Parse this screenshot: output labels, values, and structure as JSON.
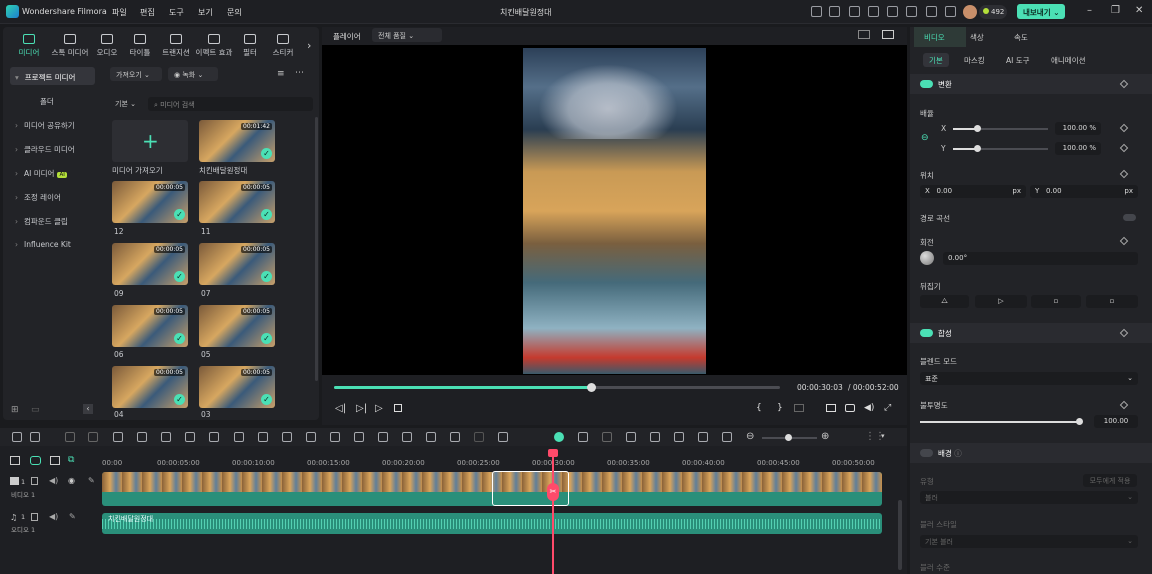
{
  "titlebar": {
    "app_name": "Wondershare Filmora",
    "menus": [
      "파일",
      "편집",
      "도구",
      "보기",
      "문의"
    ],
    "window_title": "치킨배달원정대",
    "credits": "492",
    "export_label": "내보내기 ⌄"
  },
  "left": {
    "tabs": [
      "미디어",
      "스톡 미디어",
      "오디오",
      "타이틀",
      "트랜지션",
      "이펙트 효과",
      "필터",
      "스티커"
    ],
    "sidebar": [
      {
        "label": "프로젝트 미디어",
        "tag": ""
      },
      {
        "label": "폴더",
        "tag": ""
      },
      {
        "label": "미디어 공유하기",
        "tag": ""
      },
      {
        "label": "클라우드 미디어",
        "tag": ""
      },
      {
        "label": "AI 미디어",
        "tag": "AI"
      },
      {
        "label": "조정 레이어",
        "tag": ""
      },
      {
        "label": "컴파운드 클립",
        "tag": ""
      },
      {
        "label": "Influence Kit",
        "tag": ""
      }
    ],
    "import_btn": "가져오기",
    "record_btn": "녹화",
    "sort_btn": "기본",
    "search_placeholder": "미디어 검색",
    "media": [
      {
        "name": "미디어 가져오기",
        "duration": ""
      },
      {
        "name": "치킨배달원정대",
        "duration": "00:01:42"
      },
      {
        "name": "12",
        "duration": "00:00:05"
      },
      {
        "name": "11",
        "duration": "00:00:05"
      },
      {
        "name": "09",
        "duration": "00:00:05"
      },
      {
        "name": "07",
        "duration": "00:00:05"
      },
      {
        "name": "06",
        "duration": "00:00:05"
      },
      {
        "name": "05",
        "duration": "00:00:05"
      },
      {
        "name": "04",
        "duration": "00:00:05"
      },
      {
        "name": "03",
        "duration": "00:00:05"
      }
    ]
  },
  "player": {
    "label": "플레이어",
    "quality": "전체 품질",
    "current": "00:00:30:03",
    "total": "/ 00:00:52:00",
    "progress": 0.577
  },
  "right": {
    "tabs": [
      "비디오",
      "색상",
      "속도"
    ],
    "subtabs": [
      "기본",
      "마스킹",
      "AI 도구",
      "애니메이션"
    ],
    "transform": {
      "title": "변환",
      "scale_label": "배율",
      "x": "X",
      "y": "Y",
      "scale_x": "100.00",
      "scale_y": "100.00",
      "pct": "%",
      "pos_label": "위치",
      "pos_x": "0.00",
      "pos_y": "0.00",
      "px": "px",
      "path_curve": "경로 곡선",
      "rotate_label": "회전",
      "rotate": "0.00°",
      "flip_label": "뒤집기"
    },
    "composite": {
      "title": "합성",
      "blend_label": "블렌드 모드",
      "blend": "표준",
      "opacity_label": "불투명도",
      "opacity": "100.00"
    },
    "background": {
      "title": "배경",
      "type_label": "유형",
      "apply_all": "모두에게 적용",
      "type": "블러",
      "style_label": "블러 스타일",
      "style": "기본 블러",
      "level_label": "블러 수준"
    }
  },
  "timeline": {
    "ticks": [
      "00:00",
      "00:00:05:00",
      "00:00:10:00",
      "00:00:15:00",
      "00:00:20:00",
      "00:00:25:00",
      "00:00:30:00",
      "00:00:35:00",
      "00:00:40:00",
      "00:00:45:00",
      "00:00:50:00"
    ],
    "video_track": "비디오 1",
    "audio_track": "오디오 1",
    "audio_clip": "치킨배달원정대"
  }
}
